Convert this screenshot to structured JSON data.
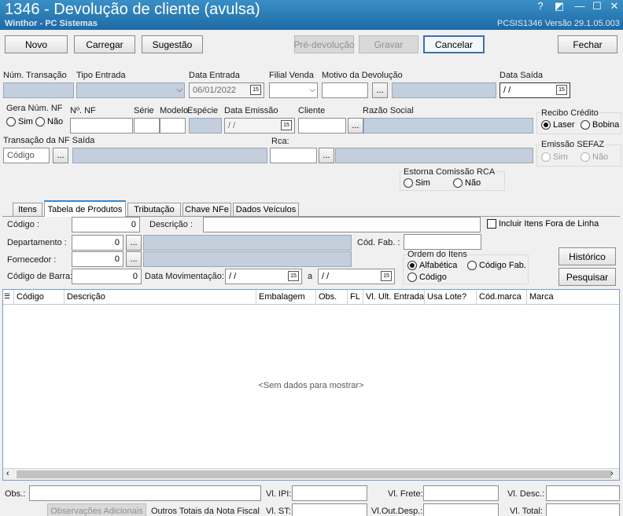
{
  "window": {
    "title": "1346 - Devolução de cliente (avulsa)",
    "subtitle": "Winthor - PC Sistemas",
    "version": "PCSIS1346  Versão  29.1.05.003",
    "controls": {
      "help": "?",
      "restore": "◩",
      "minimize": "—",
      "maximize": "☐",
      "close": "✕"
    }
  },
  "toolbar": {
    "novo": "Novo",
    "carregar": "Carregar",
    "sugestao": "Sugestão",
    "pre_devolucao": "Pré-devolução",
    "gravar": "Gravar",
    "cancelar": "Cancelar",
    "fechar": "Fechar"
  },
  "header": {
    "num_transacao": {
      "label": "Núm. Transação",
      "value": ""
    },
    "tipo_entrada": {
      "label": "Tipo Entrada",
      "value": ""
    },
    "data_entrada": {
      "label": "Data Entrada",
      "value": "06/01/2022"
    },
    "filial_venda": {
      "label": "Filial Venda",
      "value": ""
    },
    "motivo_devolucao": {
      "label": "Motivo da Devolução",
      "value": ""
    },
    "data_saida": {
      "label": "Data Saída",
      "value": "/ /"
    },
    "gera_num_nf": {
      "label": "Gera Núm. NF",
      "options": [
        "Sim",
        "Não"
      ]
    },
    "num_nf": {
      "label": "Nº. NF",
      "value": ""
    },
    "serie": {
      "label": "Série"
    },
    "modelo": {
      "label": "Modelo"
    },
    "especie": {
      "label": "Espécie"
    },
    "data_emissao": {
      "label": "Data Emissão",
      "value": "/ /"
    },
    "cliente": {
      "label": "Cliente"
    },
    "razao_social": {
      "label": "Razão Social"
    },
    "recibo_credito": {
      "label": "Recibo Crédito",
      "options": [
        "Laser",
        "Bobina"
      ],
      "selected": "Laser"
    },
    "transacao_nf_saida": {
      "label": "Transação da NF Saída",
      "placeholder": "Código"
    },
    "rca": {
      "label": "Rca:"
    },
    "emissao_sefaz": {
      "label": "Emissão SEFAZ",
      "options": [
        "Sim",
        "Não"
      ]
    },
    "estorna_comissao": {
      "label": "Estorna Comissão RCA",
      "options": [
        "Sim",
        "Não"
      ]
    }
  },
  "tabs": [
    "Itens",
    "Tabela de Produtos",
    "Tributação",
    "Chave NFe",
    "Dados Veículos"
  ],
  "filters": {
    "codigo": {
      "label": "Código :",
      "value": "0"
    },
    "descricao": {
      "label": "Descrição :",
      "value": ""
    },
    "incluir_fora_linha": "Incluir Itens Fora de Linha",
    "departamento": {
      "label": "Departamento :",
      "value": "0"
    },
    "cod_fab": {
      "label": "Cód. Fab. :"
    },
    "fornecedor": {
      "label": "Fornecedor :",
      "value": "0"
    },
    "ordem": {
      "label": "Ordem do Itens",
      "options": [
        "Alfabética",
        "Código Fab.",
        "Código"
      ],
      "selected": "Alfabética"
    },
    "codigo_barra": {
      "label": "Código de Barra:",
      "value": "0"
    },
    "data_movimentacao": {
      "label": "Data Movimentação:",
      "from": "/ /",
      "sep": "a",
      "to": "/ /"
    },
    "historico": "Histórico",
    "pesquisar": "Pesquisar"
  },
  "grid": {
    "columns": [
      "Código",
      "Descrição",
      "Embalagem",
      "Obs.",
      "FL",
      "Vl. Ult. Entrada",
      "Usa Lote?",
      "Cód.marca",
      "Marca"
    ],
    "empty_text": "<Sem dados para mostrar>"
  },
  "footer": {
    "obs": "Obs.:",
    "vl_ipi": "Vl. IPI:",
    "vl_frete": "Vl. Frete:",
    "vl_desc": "Vl. Desc.:",
    "obs_adicionais": "Observações Adicionais",
    "outros_totais": "Outros Totais da Nota Fiscal",
    "vl_st": "Vl. ST:",
    "vl_out_desp": "Vl.Out.Desp.:",
    "vl_total": "Vl. Total:"
  }
}
